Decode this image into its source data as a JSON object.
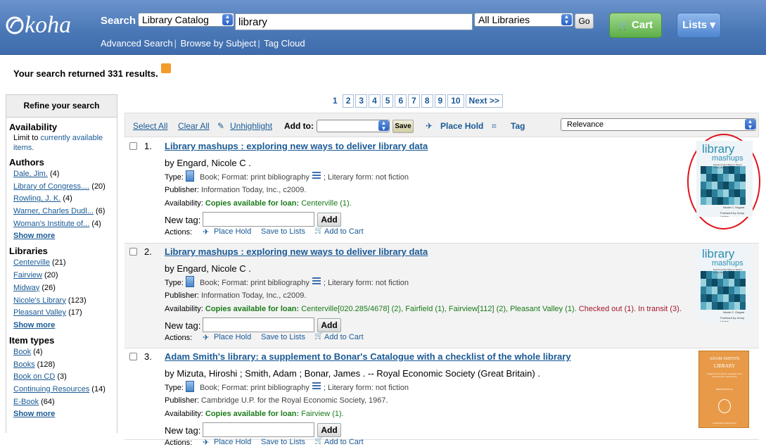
{
  "header": {
    "logo_text": "koha",
    "search_label": "Search",
    "index_select": "Library Catalog",
    "query": "library",
    "branch_select": "All Libraries",
    "go_label": "Go",
    "cart_label": "Cart",
    "lists_label": "Lists ▾",
    "links": [
      "Advanced Search",
      "Browse by Subject",
      "Tag Cloud"
    ]
  },
  "summary": "Your search returned 331 results.",
  "refine": {
    "title": "Refine your search",
    "availability": {
      "heading": "Availability",
      "text": "Limit to ",
      "link": "currently available",
      "link2": "items."
    },
    "authors": {
      "heading": "Authors",
      "items": [
        {
          "name": "Dale, Jim.",
          "count": "(4)"
        },
        {
          "name": "Library of Congress....",
          "count": "(20)"
        },
        {
          "name": "Rowling, J. K.",
          "count": "(4)"
        },
        {
          "name": "Warner, Charles Dudl...",
          "count": "(6)"
        },
        {
          "name": "Woman's Institute of...",
          "count": "(4)"
        }
      ]
    },
    "libraries": {
      "heading": "Libraries",
      "items": [
        {
          "name": "Centerville",
          "count": "(21)"
        },
        {
          "name": "Fairview",
          "count": "(20)"
        },
        {
          "name": "Midway",
          "count": "(26)"
        },
        {
          "name": "Nicole's Library",
          "count": "(123)"
        },
        {
          "name": "Pleasant Valley",
          "count": "(17)"
        }
      ]
    },
    "itemtypes": {
      "heading": "Item types",
      "items": [
        {
          "name": "Book",
          "count": "(4)"
        },
        {
          "name": "Books",
          "count": "(128)"
        },
        {
          "name": "Book on CD",
          "count": "(3)"
        },
        {
          "name": "Continuing Resources",
          "count": "(14)"
        },
        {
          "name": "E-Book",
          "count": "(64)"
        }
      ]
    },
    "show_more": "Show more"
  },
  "pager": [
    "1",
    "2",
    "3",
    "4",
    "5",
    "6",
    "7",
    "8",
    "9",
    "10",
    "Next >>"
  ],
  "toolbar": {
    "select_all": "Select All",
    "clear_all": "Clear All",
    "unhighlight": "Unhighlight",
    "add_to": "Add to:",
    "save": "Save",
    "place_hold": "Place Hold",
    "tag": "Tag",
    "sort": "Relevance"
  },
  "labels": {
    "type": "Type:",
    "publisher": "Publisher:",
    "availability": "Availability:",
    "new_tag": "New tag:",
    "add": "Add",
    "actions": "Actions:",
    "place_hold": "Place Hold",
    "save_to_lists": "Save to Lists",
    "add_to_cart": "Add to Cart"
  },
  "results": [
    {
      "num": "1.",
      "title": "Library mashups : exploring new ways to deliver library data",
      "by": "by Engard, Nicole C .",
      "type_text": "Book; Format: print bibliography",
      "form_text": "; Literary form: not fiction",
      "publisher": "Information Today, Inc., c2009.",
      "avail_label": "Copies available for loan:",
      "avail": "Centerville (1).",
      "extra": ""
    },
    {
      "num": "2.",
      "title": "Library mashups : exploring new ways to deliver library data",
      "by": "by Engard, Nicole C .",
      "type_text": "Book; Format: print bibliography",
      "form_text": "; Literary form: not fiction",
      "publisher": "Information Today, Inc., c2009.",
      "avail_label": "Copies available for loan:",
      "avail": "Centerville[020.285/4678] (2), Fairfield (1), Fairview[112] (2), Pleasant Valley (1).",
      "extra": "Checked out (1). In transit (3)."
    },
    {
      "num": "3.",
      "title": "Adam Smith's library: a supplement to Bonar's Catalogue with a checklist of the whole library",
      "by": "by Mizuta, Hiroshi ; Smith, Adam ; Bonar, James . -- Royal Economic Society (Great Britain) .",
      "type_text": "Book; Format: print bibliography",
      "form_text": "; Literary form: not fiction",
      "publisher": "Cambridge U.P. for the Royal Economic Society, 1967.",
      "avail_label": "Copies available for loan:",
      "avail": "Fairview (1).",
      "extra": ""
    }
  ],
  "covers": {
    "mashups": {
      "line1": "library",
      "line2": "mashups",
      "sub": "Exploring New Ways to Deliver Library Data",
      "editor": "Nicole C. Engard",
      "foreword": "Foreword by Jenny Levine"
    },
    "adam": {
      "line1": "ADAM SMITH'S",
      "line2": "LIBRARY",
      "sub": "A Supplement to Bonar's Catalogue with a checklist of the whole Library",
      "author": "HIROSHI MIZUTA",
      "press": "Cambridge University Press"
    }
  },
  "colors": {
    "header": "#4977b6",
    "link": "#1a5a96",
    "available": "#1a7b1a",
    "checked_out": "#a3162a",
    "highlight_circle": "#e0121b",
    "cart": "#5db04a"
  }
}
